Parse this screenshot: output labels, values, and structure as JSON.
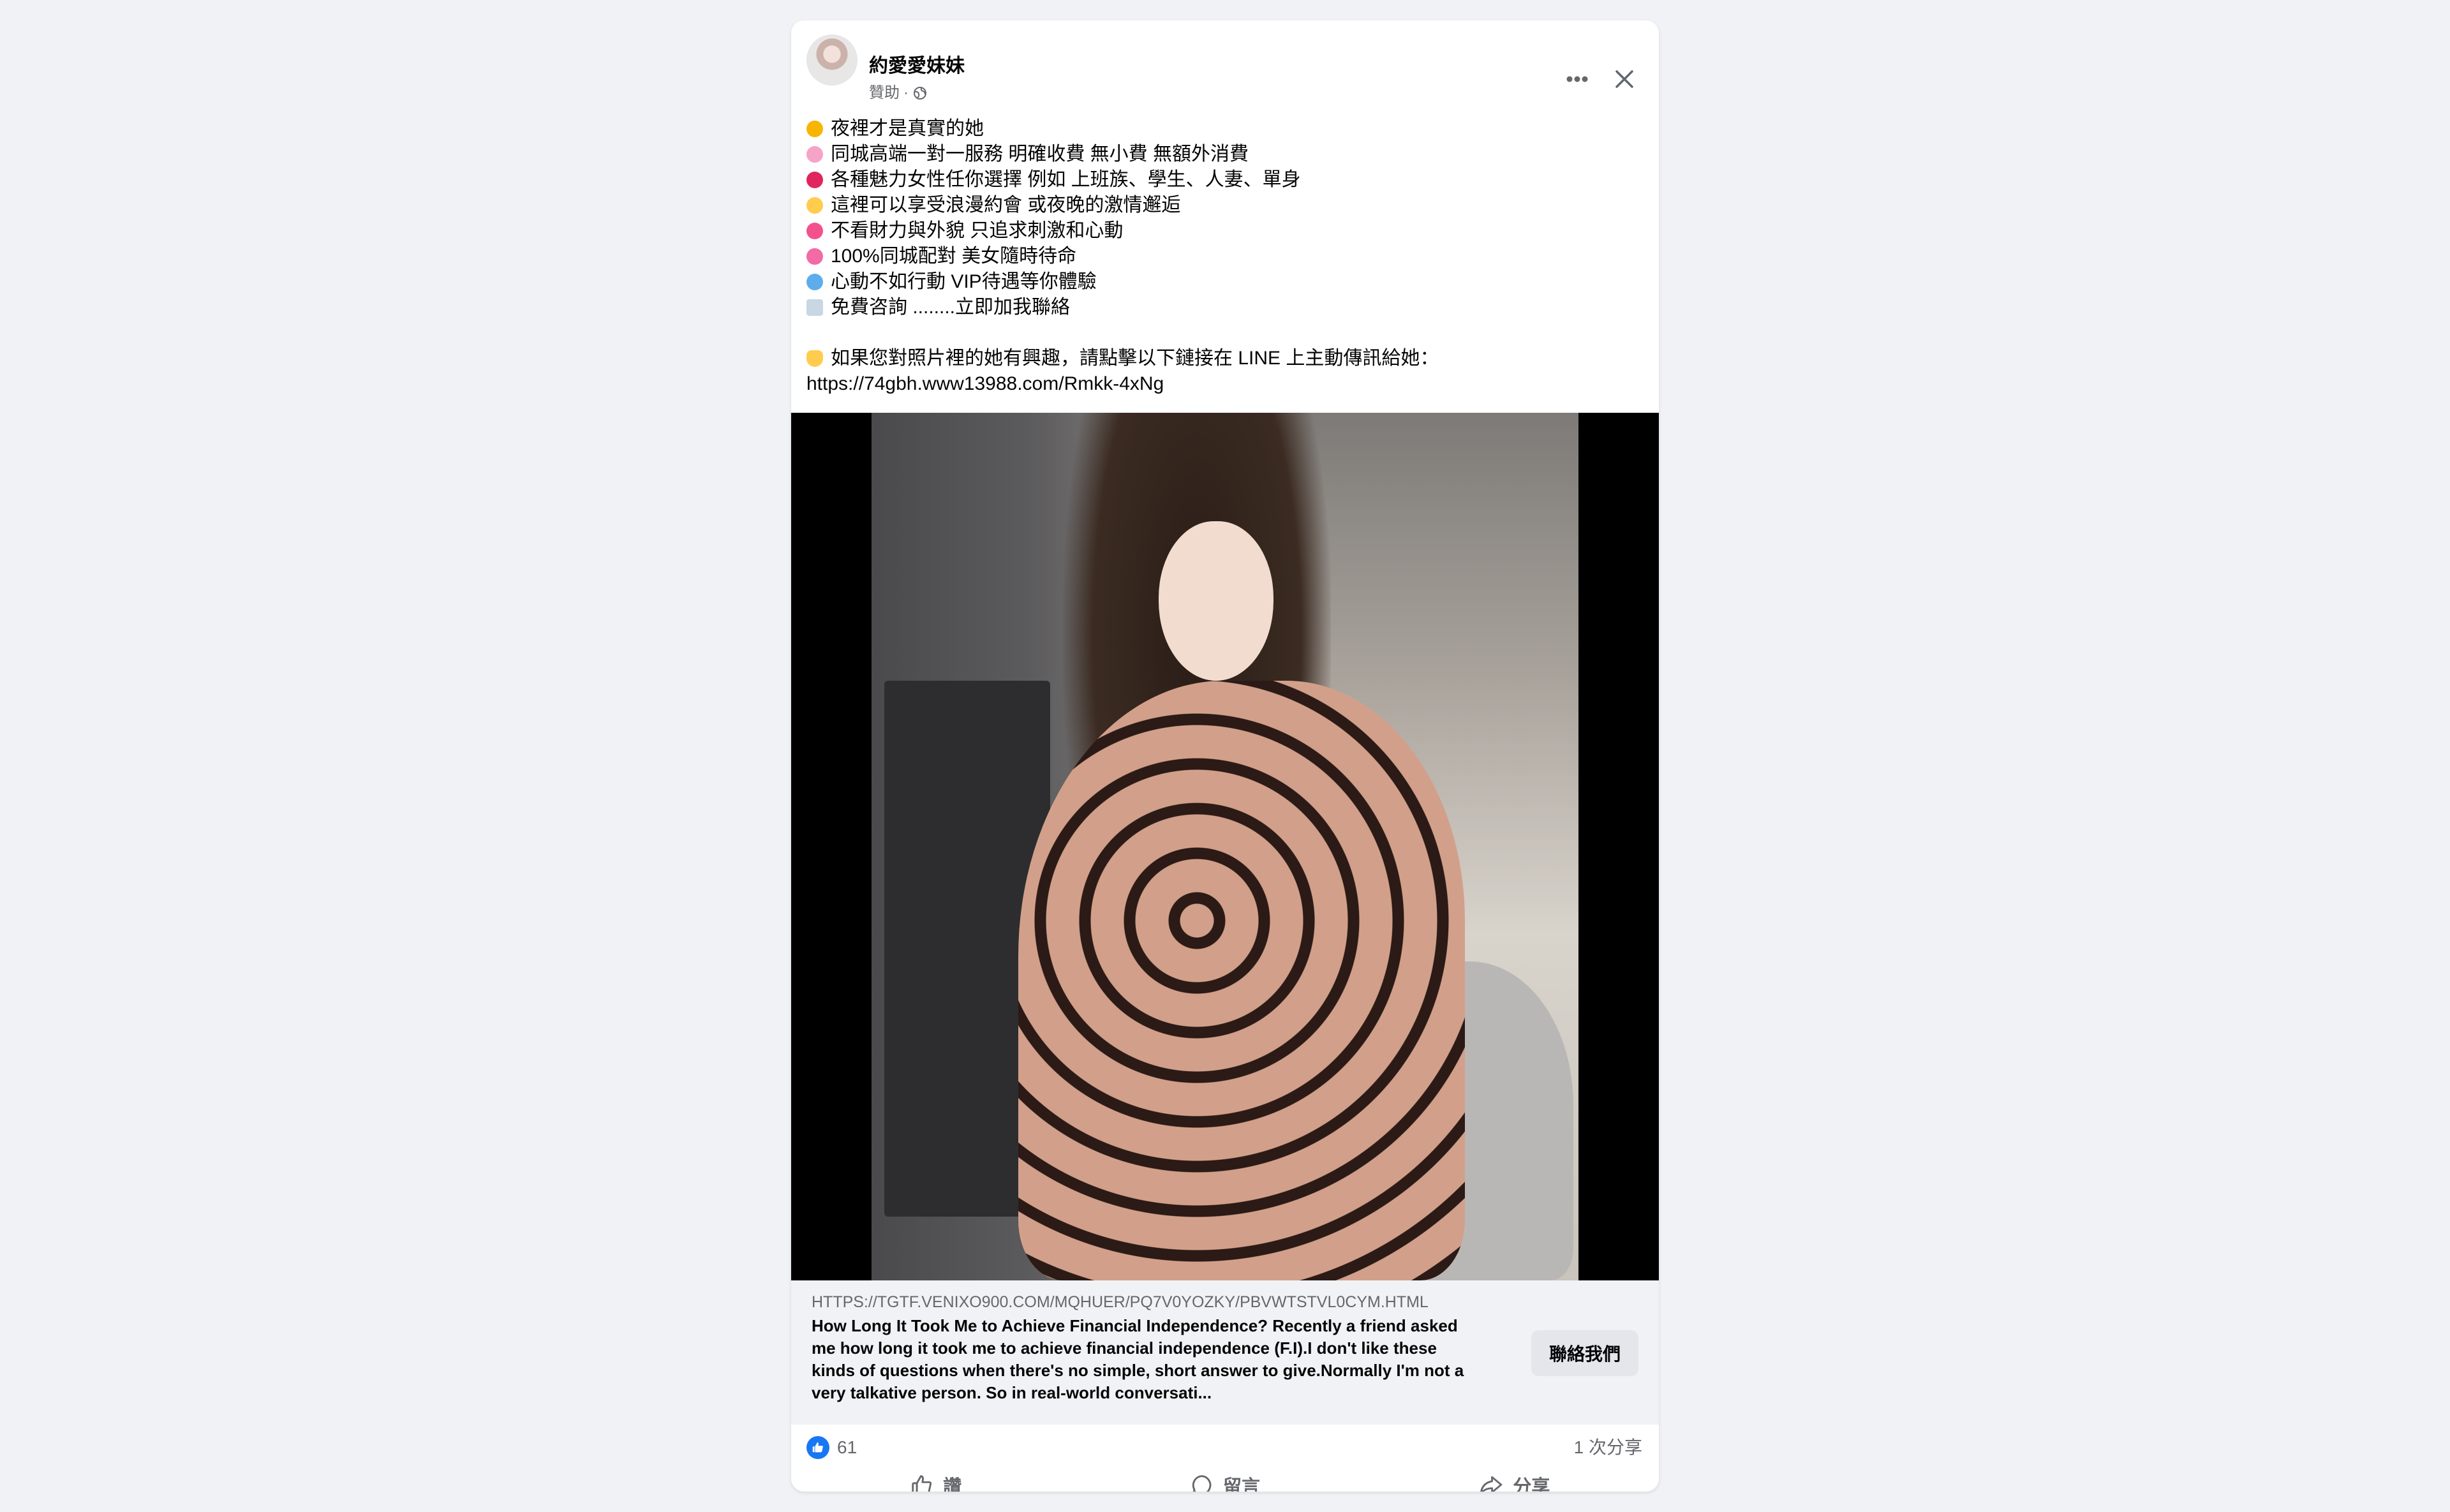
{
  "post": {
    "author": "約愛愛妹妹",
    "sponsored": "贊助",
    "dot": "·",
    "icons": {
      "avatar": "avatar",
      "visibility": "globe-icon",
      "more": "more-icon",
      "close": "close-icon"
    },
    "lines": [
      {
        "icon": "emoji-smirk",
        "color": "#f7b500",
        "text": "夜裡才是真實的她"
      },
      {
        "icon": "emoji-flower",
        "color": "#f5a3c7",
        "text": "同城高端一對一服務 明確收費 無小費 無額外消費"
      },
      {
        "icon": "emoji-lips",
        "color": "#e0245e",
        "text": "各種魅力女性任你選擇 例如 上班族、學生、人妻、單身"
      },
      {
        "icon": "emoji-sparkle",
        "color": "#ffcc4d",
        "text": "這裡可以享受浪漫約會 或夜晚的激情邂逅"
      },
      {
        "icon": "emoji-heart-arrow",
        "color": "#f4508e",
        "text": "不看財力與外貌 只追求刺激和心動"
      },
      {
        "icon": "emoji-two-hearts",
        "color": "#f26aa6",
        "text": "100%同城配對 美女隨時待命"
      },
      {
        "icon": "emoji-gem",
        "color": "#5dadec",
        "text": "心動不如行動 VIP待遇等你體驗"
      },
      {
        "icon": "emoji-envelope",
        "color": "#c9d6e3",
        "text": "免費咨詢 ........立即加我聯絡"
      }
    ],
    "cta_line": {
      "icon": "emoji-point-down",
      "color": "#ffcc4d",
      "text": "如果您對照片裡的她有興趣，請點擊以下鏈接在 LINE 上主動傳訊給她："
    },
    "link": "https://74gbh.www13988.com/Rmkk-4xNg"
  },
  "image": {
    "alt_name": "post-photo"
  },
  "link_preview": {
    "url": "HTTPS://TGTF.VENIXO900.COM/MQHUER/PQ7V0YOZKY/PBVWTSTVL0CYM.HTML",
    "description": "How Long It Took Me to Achieve Financial Independence? Recently a friend asked me how long it took me to achieve financial independence (F.I).I don't like these kinds of questions when there's no simple, short answer to give.Normally I'm not a very talkative person. So in real-world conversati...",
    "button_label": "聯絡我們"
  },
  "stats": {
    "likes": "61",
    "shares": "1 次分享"
  },
  "actions": {
    "like": "讚",
    "comment": "留言",
    "share": "分享"
  },
  "colors": {
    "background": "#f0f2f5",
    "card": "#ffffff",
    "like_blue": "#1877f2",
    "secondary_text": "#65676b"
  }
}
